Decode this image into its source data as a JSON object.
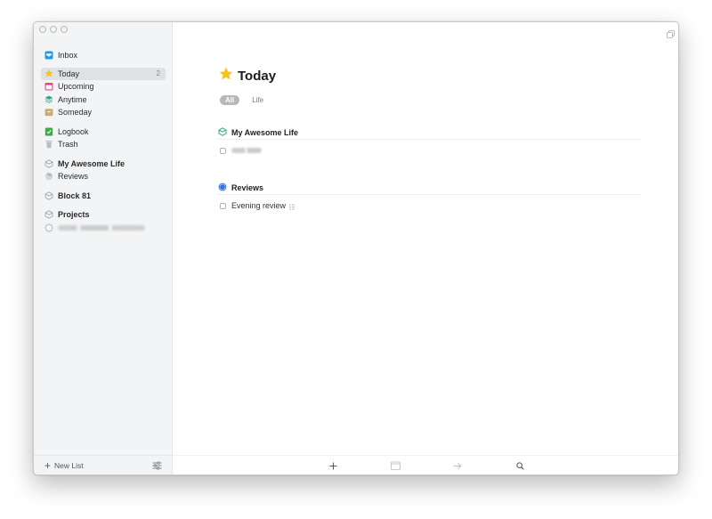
{
  "window": {
    "traffic_lights": [
      "close",
      "minimize",
      "zoom"
    ]
  },
  "sidebar": {
    "items": [
      {
        "label": "Inbox",
        "icon": "inbox-icon",
        "color": "#1e9ae8"
      },
      {
        "label": "Today",
        "icon": "star-icon",
        "color": "#f5c518",
        "count": "2",
        "selected": true
      },
      {
        "label": "Upcoming",
        "icon": "calendar-icon",
        "color": "#e8447a"
      },
      {
        "label": "Anytime",
        "icon": "layers-icon",
        "color": "#2fa68a"
      },
      {
        "label": "Someday",
        "icon": "archive-box-icon",
        "color": "#c9b072"
      },
      {
        "label": "Logbook",
        "icon": "checked-book-icon",
        "color": "#3fa94b"
      },
      {
        "label": "Trash",
        "icon": "trash-icon",
        "color": "#b9bcc0"
      },
      {
        "label": "My Awesome Life",
        "icon": "area-cube-icon"
      },
      {
        "label": "Reviews",
        "icon": "project-pie-icon"
      },
      {
        "label": "Block 81",
        "icon": "area-cube-icon"
      },
      {
        "label": "Projects",
        "icon": "area-cube-icon"
      },
      {
        "label": "",
        "icon": "project-circle-icon",
        "redacted": true
      }
    ],
    "footer": {
      "new_list_label": "New List",
      "settings_icon": "sliders-icon"
    }
  },
  "main": {
    "title": "Today",
    "title_icon": "star-icon",
    "tags": [
      {
        "label": "All",
        "active": true
      },
      {
        "label": "Life",
        "active": false
      }
    ],
    "sections": [
      {
        "title": "My Awesome Life",
        "icon": "area-cube-icon",
        "icon_color": "#3aa87a",
        "todos": [
          {
            "label": "",
            "redacted": true,
            "has_notes": false
          }
        ]
      },
      {
        "title": "Reviews",
        "icon": "project-pie-icon",
        "icon_color": "#2f6fd6",
        "todos": [
          {
            "label": "Evening review",
            "redacted": false,
            "has_notes": true
          }
        ]
      }
    ],
    "toolbar": {
      "buttons": [
        "add-todo",
        "when-calendar",
        "move",
        "search"
      ]
    }
  },
  "colors": {
    "accent_blue": "#2f6fd6",
    "sidebar_bg": "#f3f4f6",
    "selected_bg": "#dfe1e5"
  }
}
